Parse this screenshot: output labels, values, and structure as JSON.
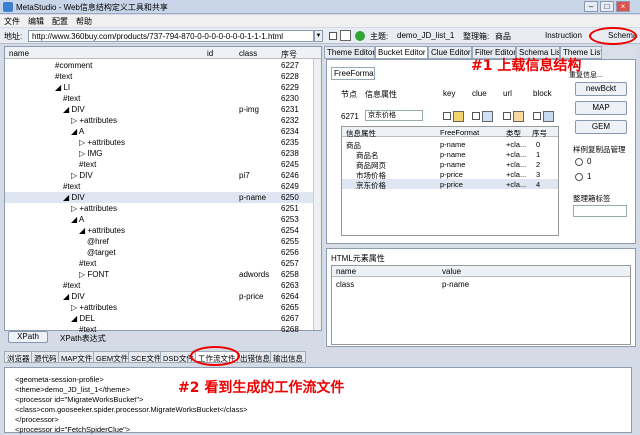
{
  "window": {
    "title": "MetaStudio - Web信息结构定义工具和共享"
  },
  "menu": [
    "文件",
    "编辑",
    "配置",
    "帮助"
  ],
  "address": {
    "label": "地址:",
    "url": "http://www.360buy.com/products/737-794-870-0-0-0-0-0-0-0-1-1-1.html",
    "theme_label": "主题:",
    "theme_value": "demo_JD_list_1",
    "organizer_label": "整理箱:",
    "organizer_value": "商品",
    "instruction": "Instruction",
    "schema": "Schema"
  },
  "tree": {
    "headers": [
      "name",
      "id",
      "class",
      "序号"
    ],
    "rows": [
      {
        "n": "#comment",
        "c": "",
        "s": "6227"
      },
      {
        "n": "#text",
        "c": "",
        "s": "6228"
      },
      {
        "n": "LI",
        "c": "",
        "s": "6229"
      },
      {
        "n": "#text",
        "c": "",
        "s": "6230"
      },
      {
        "n": "DIV",
        "c": "p-img",
        "s": "6231"
      },
      {
        "n": "+attributes",
        "c": "",
        "s": "6232"
      },
      {
        "n": "A",
        "c": "",
        "s": "6234"
      },
      {
        "n": "+attributes",
        "c": "",
        "s": "6235"
      },
      {
        "n": "IMG",
        "c": "",
        "s": "6238"
      },
      {
        "n": "#text",
        "c": "",
        "s": "6245"
      },
      {
        "n": "DIV",
        "c": "pi7",
        "s": "6246"
      },
      {
        "n": "#text",
        "c": "",
        "s": "6249"
      },
      {
        "n": "DIV",
        "c": "p-name",
        "s": "6250"
      },
      {
        "n": "+attributes",
        "c": "",
        "s": "6251"
      },
      {
        "n": "A",
        "c": "",
        "s": "6253"
      },
      {
        "n": "+attributes",
        "c": "",
        "s": "6254"
      },
      {
        "n": "@href",
        "c": "",
        "s": "6255"
      },
      {
        "n": "@target",
        "c": "",
        "s": "6256"
      },
      {
        "n": "#text",
        "c": "",
        "s": "6257"
      },
      {
        "n": "FONT",
        "c": "adwords",
        "s": "6258"
      },
      {
        "n": "#text",
        "c": "",
        "s": "6263"
      },
      {
        "n": "DIV",
        "c": "p-price",
        "s": "6264"
      },
      {
        "n": "+attributes",
        "c": "",
        "s": "6265"
      },
      {
        "n": "DEL",
        "c": "",
        "s": "6267"
      },
      {
        "n": "#text",
        "c": "",
        "s": "6268"
      }
    ]
  },
  "xpath": {
    "button": "XPath",
    "label": "XPath表达式"
  },
  "right_tabs": [
    "Theme Editor",
    "Bucket Editor",
    "Clue Editor",
    "Filter Editor",
    "Schema List",
    "Theme List"
  ],
  "bucket": {
    "freeformat": "FreeFormat",
    "headers": [
      "节点",
      "信息属性",
      "key",
      "clue",
      "url",
      "block"
    ],
    "node": "6271",
    "attr": "京东价格",
    "table_headers": [
      "信息属性",
      "FreeFormat",
      "类型",
      "序号"
    ],
    "table_rows": [
      {
        "a": "商品",
        "f": "p-name",
        "t": "+cla...",
        "s": "0"
      },
      {
        "a": "商品名",
        "f": "p-name",
        "t": "+cla...",
        "s": "1"
      },
      {
        "a": "商品网页",
        "f": "p-name",
        "t": "+cla...",
        "s": "2"
      },
      {
        "a": "市场价格",
        "f": "p-price",
        "t": "+cla...",
        "s": "3"
      },
      {
        "a": "京东价格",
        "f": "p-price",
        "t": "+cla...",
        "s": "4"
      }
    ],
    "side_cut": "重复信息...",
    "btn_new": "newBckt",
    "btn_map": "MAP",
    "btn_gem": "GEM",
    "sample_label": "样例复制品管理",
    "radio0": "0",
    "radio1": "1",
    "sort_label": "整理箱标签"
  },
  "html_props": {
    "title": "HTML元素属性",
    "headers": [
      "name",
      "value"
    ],
    "rows": [
      {
        "name": "class",
        "value": "p-name"
      }
    ]
  },
  "bottom_tabs": [
    "浏览器",
    "源代码",
    "MAP文件",
    "GEM文件",
    "SCE文件",
    "DSD文件",
    "工作流文件",
    "出错信息",
    "输出信息"
  ],
  "output": [
    "<geometa-session-profile>",
    "<theme>demo_JD_list_1</theme>",
    "<processor id=\"MigrateWorksBucket\">",
    "<class>com.gooseeker.spider.processor.MigrateWorksBucket</class>",
    "</processor>",
    "<processor id=\"FetchSpiderClue\">"
  ],
  "annotations": {
    "a1": "#1 上载信息结构",
    "a2": "#2 看到生成的工作流文件"
  },
  "colors": {
    "accent": "#e00000",
    "panel": "#d4dbe6"
  }
}
